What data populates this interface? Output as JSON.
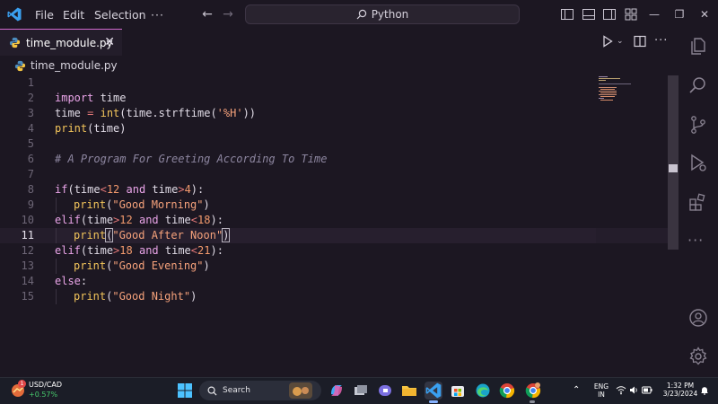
{
  "menu": {
    "file": "File",
    "edit": "Edit",
    "selection": "Selection",
    "more": "···"
  },
  "search": {
    "label": "Python"
  },
  "tab": {
    "label": "time_module.py",
    "close": "✕"
  },
  "breadcrumb": {
    "label": "time_module.py"
  },
  "editor": {
    "current_line": 11,
    "lines": [
      {
        "n": "1",
        "tokens": []
      },
      {
        "n": "2",
        "tokens": [
          [
            "t-kw",
            "import"
          ],
          [
            "t-plain",
            " time"
          ]
        ]
      },
      {
        "n": "3",
        "tokens": [
          [
            "t-plain",
            "time "
          ],
          [
            "t-op",
            "="
          ],
          [
            "t-plain",
            " "
          ],
          [
            "t-fn",
            "int"
          ],
          [
            "t-paren",
            "("
          ],
          [
            "t-plain",
            "time.strftime"
          ],
          [
            "t-paren",
            "("
          ],
          [
            "t-str",
            "'%H'"
          ],
          [
            "t-paren",
            "))"
          ]
        ]
      },
      {
        "n": "4",
        "tokens": [
          [
            "t-fn",
            "print"
          ],
          [
            "t-paren",
            "("
          ],
          [
            "t-plain",
            "time"
          ],
          [
            "t-paren",
            ")"
          ]
        ]
      },
      {
        "n": "5",
        "tokens": []
      },
      {
        "n": "6",
        "tokens": [
          [
            "t-cmt",
            "# A Program For Greeting According To Time"
          ]
        ]
      },
      {
        "n": "7",
        "tokens": []
      },
      {
        "n": "8",
        "tokens": [
          [
            "t-kw",
            "if"
          ],
          [
            "t-paren",
            "("
          ],
          [
            "t-plain",
            "time"
          ],
          [
            "t-op",
            "<"
          ],
          [
            "t-num",
            "12"
          ],
          [
            "t-plain",
            " "
          ],
          [
            "t-kw",
            "and"
          ],
          [
            "t-plain",
            " time"
          ],
          [
            "t-op",
            ">"
          ],
          [
            "t-num",
            "4"
          ],
          [
            "t-paren",
            "):"
          ]
        ]
      },
      {
        "n": "9",
        "indent": true,
        "tokens": [
          [
            "t-fn",
            "print"
          ],
          [
            "t-paren",
            "("
          ],
          [
            "t-str",
            "\"Good Morning\""
          ],
          [
            "t-paren",
            ")"
          ]
        ]
      },
      {
        "n": "10",
        "tokens": [
          [
            "t-kw",
            "elif"
          ],
          [
            "t-paren",
            "("
          ],
          [
            "t-plain",
            "time"
          ],
          [
            "t-op",
            ">"
          ],
          [
            "t-num",
            "12"
          ],
          [
            "t-plain",
            " "
          ],
          [
            "t-kw",
            "and"
          ],
          [
            "t-plain",
            " time"
          ],
          [
            "t-op",
            "<"
          ],
          [
            "t-num",
            "18"
          ],
          [
            "t-paren",
            "):"
          ]
        ]
      },
      {
        "n": "11",
        "indent": true,
        "tokens": [
          [
            "t-fn",
            "print"
          ],
          [
            "t-paren bracket-box",
            "("
          ],
          [
            "t-str",
            "\"Good After Noon\""
          ],
          [
            "t-paren bracket-box",
            ")"
          ]
        ]
      },
      {
        "n": "12",
        "tokens": [
          [
            "t-kw",
            "elif"
          ],
          [
            "t-paren",
            "("
          ],
          [
            "t-plain",
            "time"
          ],
          [
            "t-op",
            ">"
          ],
          [
            "t-num",
            "18"
          ],
          [
            "t-plain",
            " "
          ],
          [
            "t-kw",
            "and"
          ],
          [
            "t-plain",
            " time"
          ],
          [
            "t-op",
            "<"
          ],
          [
            "t-num",
            "21"
          ],
          [
            "t-paren",
            "):"
          ]
        ]
      },
      {
        "n": "13",
        "indent": true,
        "tokens": [
          [
            "t-fn",
            "print"
          ],
          [
            "t-paren",
            "("
          ],
          [
            "t-str",
            "\"Good Evening\""
          ],
          [
            "t-paren",
            ")"
          ]
        ]
      },
      {
        "n": "14",
        "tokens": [
          [
            "t-kw",
            "else"
          ],
          [
            "t-paren",
            ":"
          ]
        ]
      },
      {
        "n": "15",
        "indent": true,
        "tokens": [
          [
            "t-fn",
            "print"
          ],
          [
            "t-paren",
            "("
          ],
          [
            "t-str",
            "\"Good Night\""
          ],
          [
            "t-paren",
            ")"
          ]
        ]
      }
    ]
  },
  "colors": {
    "accent": "#d16acf",
    "background": "#1c1722"
  },
  "activity_icons": [
    "explorer-icon",
    "search-icon",
    "source-control-icon",
    "run-debug-icon",
    "extensions-icon",
    "more-icon",
    "account-icon",
    "settings-gear-icon"
  ],
  "taskbar": {
    "ticker_label": "USD/CAD",
    "ticker_value": "+0.57%",
    "badge": "1",
    "search_label": "Search",
    "lang_top": "ENG",
    "lang_bottom": "IN",
    "time": "1:32 PM",
    "date": "3/23/2024"
  }
}
